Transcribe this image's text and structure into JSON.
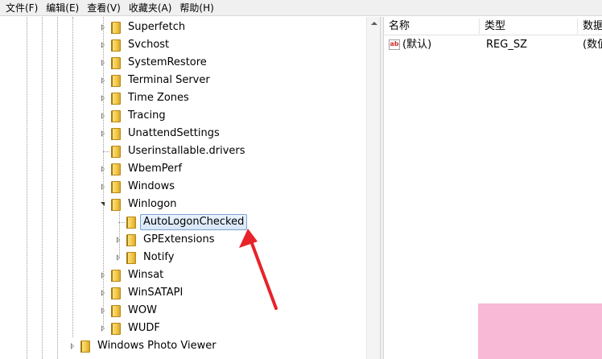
{
  "menubar": {
    "items": [
      {
        "label": "文件(F)"
      },
      {
        "label": "编辑(E)"
      },
      {
        "label": "查看(V)"
      },
      {
        "label": "收藏夹(A)"
      },
      {
        "label": "帮助(H)"
      }
    ]
  },
  "tree": {
    "items": [
      {
        "label": "Superfetch",
        "state": "collapsed"
      },
      {
        "label": "Svchost",
        "state": "collapsed"
      },
      {
        "label": "SystemRestore",
        "state": "collapsed"
      },
      {
        "label": "Terminal Server",
        "state": "collapsed"
      },
      {
        "label": "Time Zones",
        "state": "collapsed"
      },
      {
        "label": "Tracing",
        "state": "collapsed"
      },
      {
        "label": "UnattendSettings",
        "state": "collapsed"
      },
      {
        "label": "Userinstallable.drivers",
        "state": "leaf"
      },
      {
        "label": "WbemPerf",
        "state": "collapsed"
      },
      {
        "label": "Windows",
        "state": "collapsed"
      },
      {
        "label": "Winlogon",
        "state": "expanded"
      },
      {
        "label": "AutoLogonChecked",
        "state": "leaf",
        "selected": true
      },
      {
        "label": "GPExtensions",
        "state": "collapsed"
      },
      {
        "label": "Notify",
        "state": "collapsed"
      },
      {
        "label": "Winsat",
        "state": "collapsed"
      },
      {
        "label": "WinSATAPI",
        "state": "collapsed"
      },
      {
        "label": "WOW",
        "state": "collapsed"
      },
      {
        "label": "WUDF",
        "state": "collapsed"
      },
      {
        "label": "Windows Photo Viewer",
        "state": "collapsed"
      }
    ]
  },
  "list": {
    "columns": [
      {
        "label": "名称"
      },
      {
        "label": "类型"
      },
      {
        "label": "数据"
      }
    ],
    "rows": [
      {
        "name": "(默认)",
        "type": "REG_SZ",
        "data": "(数值未设置)",
        "icon": "ab"
      }
    ]
  },
  "colors": {
    "selection_border": "#7da2ce",
    "arrow": "#e8232a",
    "pink_overlay": "#f7b9d6"
  }
}
